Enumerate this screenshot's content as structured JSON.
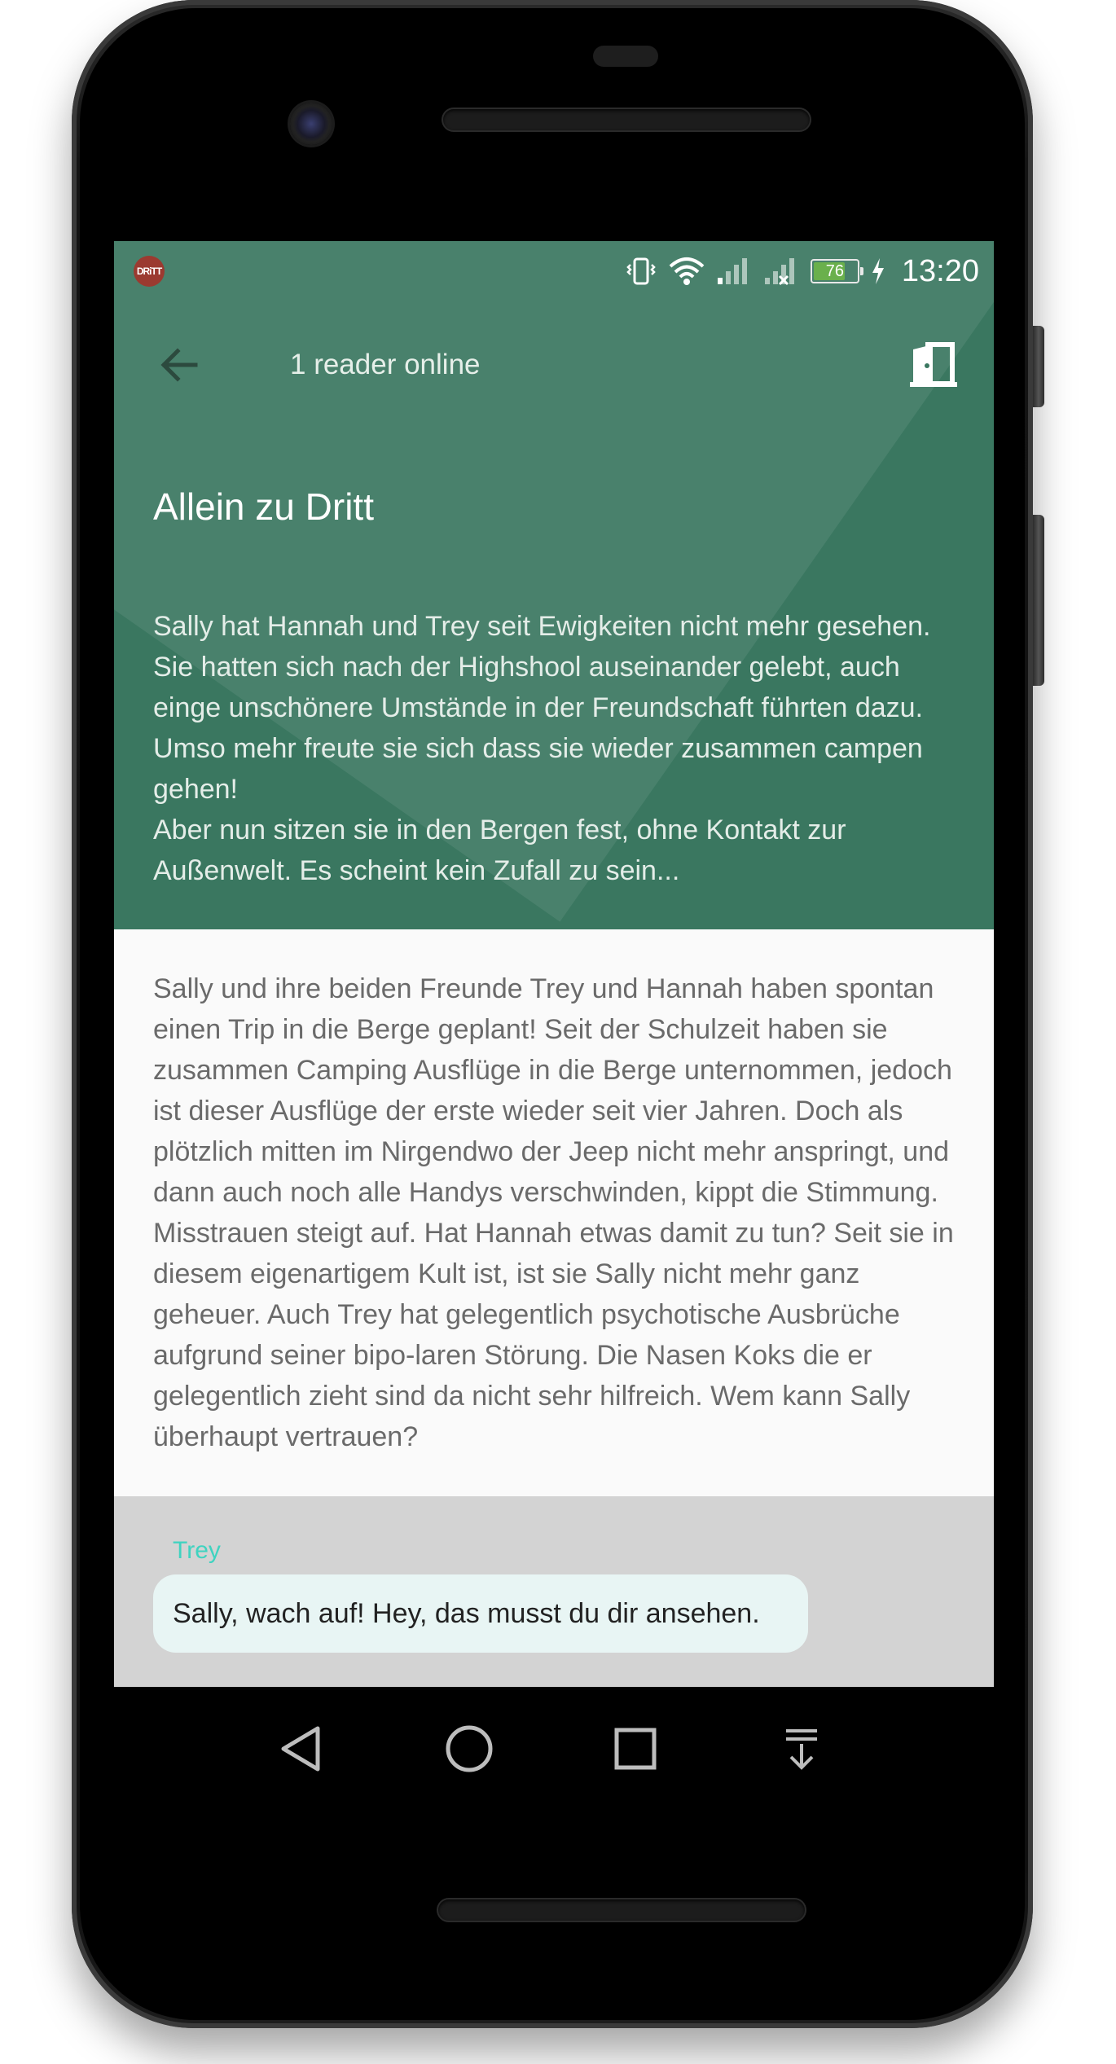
{
  "status_bar": {
    "app_badge": "DRiTT",
    "battery_level": 76,
    "battery_text": "76",
    "time": "13:20",
    "icons": [
      "vibrate-icon",
      "wifi-icon",
      "signal-icon",
      "signal-no-service-icon",
      "battery-icon",
      "charging-icon"
    ]
  },
  "toolbar": {
    "back_icon": "arrow-left-icon",
    "title": "1 reader online",
    "exit_icon": "exit-door-icon"
  },
  "story": {
    "title": "Allein zu Dritt",
    "description": "Sally hat Hannah und Trey seit Ewigkeiten nicht mehr gesehen. Sie hatten sich nach der Highshool auseinander gelebt, auch einge unschönere Umstände in der Freundschaft führten dazu. Umso mehr freute sie sich dass sie wieder zusammen campen gehen!\nAber nun sitzen sie in den Bergen fest, ohne Kontakt zur Außenwelt. Es scheint kein Zufall zu sein...",
    "body": "Sally und ihre beiden Freunde Trey und Hannah haben spontan einen Trip in die Berge geplant! Seit der Schulzeit haben sie zusammen Camping Ausflüge in die Berge unternommen, jedoch ist dieser Ausflüge der erste wieder seit vier Jahren. Doch als plötzlich mitten im Nirgendwo der Jeep nicht mehr anspringt, und dann auch noch alle Handys verschwinden, kippt die Stimmung. Misstrauen steigt auf. Hat Hannah etwas damit zu tun? Seit sie in diesem eigenartigem Kult ist, ist sie Sally nicht mehr ganz geheuer. Auch Trey hat gelegentlich psychotische Ausbrüche aufgrund seiner bipo-laren Störung. Die Nasen Koks die er gelegentlich zieht sind da nicht sehr hilfreich. Wem kann Sally überhaupt vertrauen?"
  },
  "chat": {
    "messages": [
      {
        "sender": "Trey",
        "text": "Sally, wach auf! Hey, das musst du dir ansehen."
      }
    ]
  },
  "navbar": {
    "buttons": [
      "back-triangle-icon",
      "home-circle-icon",
      "recents-square-icon",
      "notification-pulldown-icon"
    ]
  },
  "colors": {
    "header_green": "#3a7760",
    "sender_teal": "#3fd3c0",
    "bubble_bg": "#e8f5f4",
    "chat_bg": "#d3d3d3",
    "body_bg": "#fafafa"
  }
}
